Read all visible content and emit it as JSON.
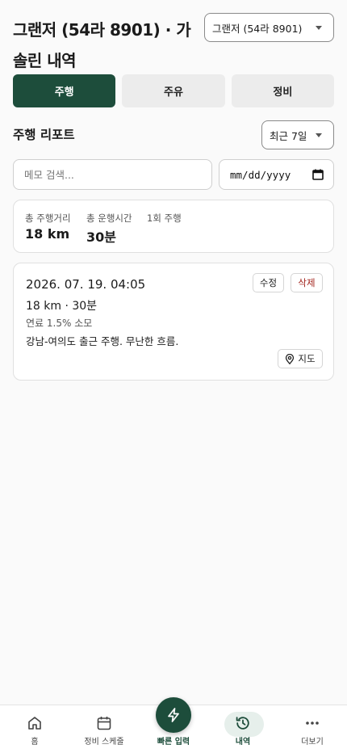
{
  "header": {
    "title": "그랜저 (54라 8901) · 가솔린 내역",
    "vehicle_select": "그랜저 (54라 8901)"
  },
  "tabs": [
    {
      "label": "주행",
      "active": true
    },
    {
      "label": "주유",
      "active": false
    },
    {
      "label": "정비",
      "active": false
    }
  ],
  "report": {
    "title": "주행 리포트",
    "period": "최근 7일"
  },
  "filters": {
    "search_placeholder": "메모 검색...",
    "date_placeholder": "mm/dd/yyyy"
  },
  "summary": {
    "distance_label": "총 주행거리",
    "distance_value": "18 km",
    "time_label": "총 운행시간",
    "time_value": "30분",
    "count_label": "1회 주행"
  },
  "trips": [
    {
      "datetime": "2026. 07. 19. 04:05",
      "summary": "18 km · 30분",
      "fuel": "연료 1.5% 소모",
      "memo": "강남-여의도 출근 주행. 무난한 흐름.",
      "edit_label": "수정",
      "delete_label": "삭제",
      "map_label": "지도"
    }
  ],
  "nav": {
    "home": "홈",
    "schedule": "정비 스케줄",
    "quick": "빠른 입력",
    "history": "내역",
    "more": "더보기",
    "active": "history"
  },
  "colors": {
    "primary": "#1d4d3b",
    "danger": "#a3261f",
    "background": "#fafafa"
  }
}
